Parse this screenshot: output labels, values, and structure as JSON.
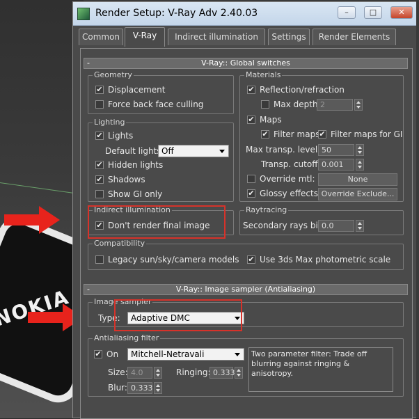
{
  "window": {
    "title": "Render Setup: V-Ray Adv 2.40.03",
    "minimize": "–",
    "maximize": "□",
    "close": "✕"
  },
  "tabs": [
    "Common",
    "V-Ray",
    "Indirect illumination",
    "Settings",
    "Render Elements"
  ],
  "global_switches": {
    "header": "V-Ray:: Global switches",
    "geometry": {
      "title": "Geometry",
      "displacement": "Displacement",
      "force_back_face": "Force back face culling"
    },
    "lighting": {
      "title": "Lighting",
      "lights": "Lights",
      "default_lights_label": "Default lights",
      "default_lights_value": "Off",
      "hidden_lights": "Hidden lights",
      "shadows": "Shadows",
      "show_gi_only": "Show GI only"
    },
    "materials": {
      "title": "Materials",
      "reflection_refraction": "Reflection/refraction",
      "max_depth_label": "Max depth",
      "max_depth_value": "2",
      "maps": "Maps",
      "filter_maps": "Filter maps",
      "filter_maps_gi": "Filter maps for GI",
      "max_transp_label": "Max transp. levels",
      "max_transp_value": "50",
      "transp_cutoff_label": "Transp. cutoff",
      "transp_cutoff_value": "0.001",
      "override_mtl": "Override mtl:",
      "override_value": "None",
      "glossy_effects": "Glossy effects",
      "override_exclude": "Override Exclude..."
    },
    "indirect": {
      "title": "Indirect illumination",
      "dont_render": "Don't render final image"
    },
    "raytracing": {
      "title": "Raytracing",
      "secondary_bias_label": "Secondary rays bias",
      "secondary_bias_value": "0.0"
    },
    "compatibility": {
      "title": "Compatibility",
      "legacy": "Legacy sun/sky/camera models",
      "photometric": "Use 3ds Max photometric scale"
    }
  },
  "image_sampler": {
    "header": "V-Ray:: Image sampler (Antialiasing)",
    "sampler": {
      "title": "Image sampler",
      "type_label": "Type:",
      "type_value": "Adaptive DMC"
    },
    "aa_filter": {
      "title": "Antialiasing filter",
      "on_label": "On",
      "filter_value": "Mitchell-Netravali",
      "description": "Two parameter filter: Trade off blurring against ringing & anisotropy.",
      "size_label": "Size:",
      "size_value": "4.0",
      "ringing_label": "Ringing:",
      "ringing_value": "0.333",
      "blur_label": "Blur:",
      "blur_value": "0.333"
    }
  },
  "viewport": {
    "logo_text": "NOKIA"
  },
  "colors": {
    "highlight": "#d7322a",
    "titlebar": "#c4d6ea"
  }
}
